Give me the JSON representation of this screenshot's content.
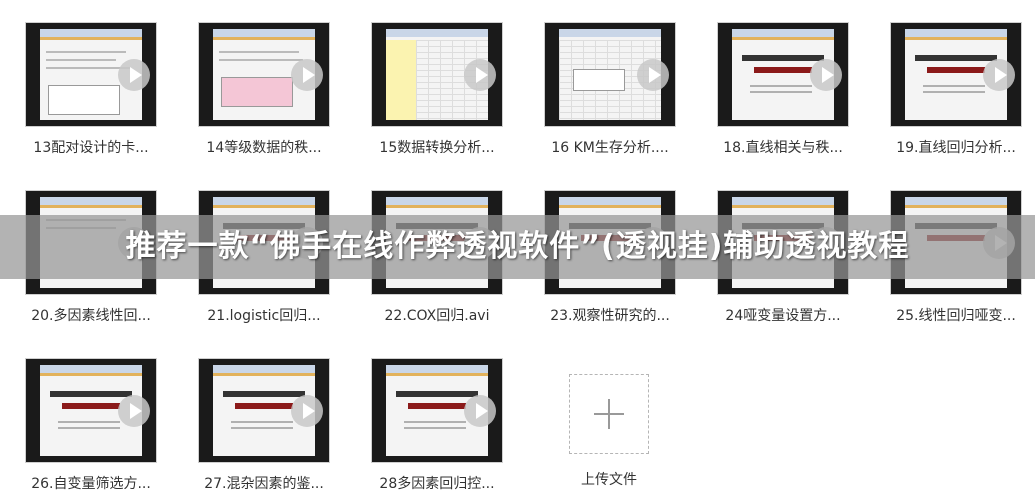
{
  "banner": {
    "title": "推荐一款“佛手在线作弊透视软件”(透视挂)辅助透视教程"
  },
  "files": [
    {
      "name": "13配对设计的卡..."
    },
    {
      "name": "14等级数据的秩..."
    },
    {
      "name": "15数据转换分析..."
    },
    {
      "name": "16 KM生存分析...."
    },
    {
      "name": "18.直线相关与秩..."
    },
    {
      "name": "19.直线回归分析..."
    },
    {
      "name": "20.多因素线性回..."
    },
    {
      "name": "21.logistic回归..."
    },
    {
      "name": "22.COX回归.avi"
    },
    {
      "name": "23.观察性研究的..."
    },
    {
      "name": "24哑变量设置方..."
    },
    {
      "name": "25.线性回归哑变..."
    },
    {
      "name": "26.自变量筛选方..."
    },
    {
      "name": "27.混杂因素的鉴..."
    },
    {
      "name": "28多因素回归控..."
    }
  ],
  "upload": {
    "label": "上传文件"
  },
  "icons": {
    "play": "play-icon",
    "upload": "plus-icon"
  }
}
